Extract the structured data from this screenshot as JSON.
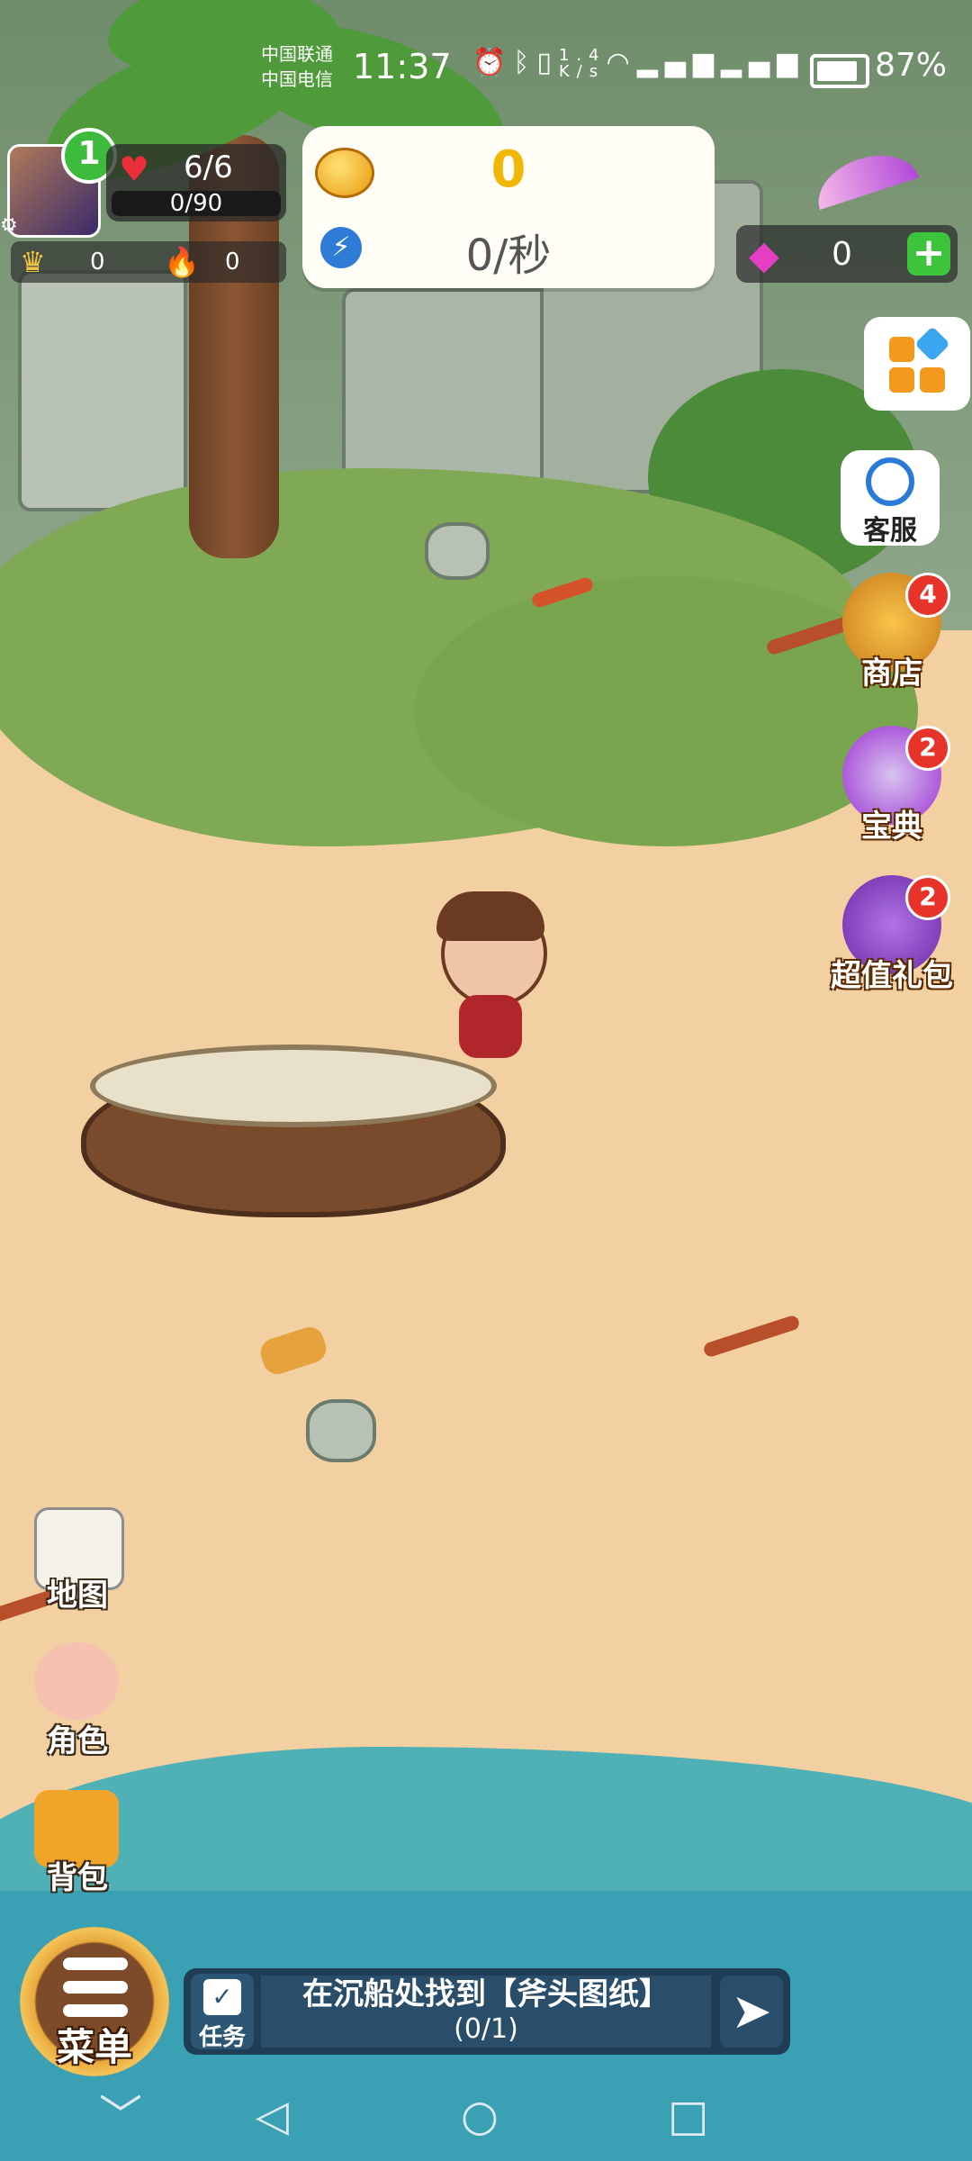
{
  "status_bar": {
    "carrier_1": "中国联通",
    "carrier_2": "中国电信",
    "time": "11:37",
    "net_speed": "1.4\nK/s",
    "battery_percent": "87%",
    "battery_level": 0.87,
    "icons": [
      "alarm-icon",
      "bluetooth-icon",
      "vibrate-icon",
      "wifi-icon",
      "signal-4g-icon",
      "signal-4g-icon"
    ]
  },
  "player": {
    "level": "1",
    "hp": "6/6",
    "xp": "0/90",
    "crowns": "0",
    "fire": "0"
  },
  "resources": {
    "gold": "0",
    "gold_rate": "0/秒"
  },
  "gems": {
    "count": "0",
    "add_label": "+"
  },
  "right_menu": {
    "customer_service": "客服",
    "shop": {
      "label": "商店",
      "badge": "4"
    },
    "codex": {
      "label": "宝典",
      "badge": "2"
    },
    "gift_pack": {
      "label": "超值礼包",
      "badge": "2"
    }
  },
  "left_menu": {
    "map": "地图",
    "character": "角色",
    "backpack": "背包"
  },
  "bottom": {
    "menu": "菜单",
    "task_label": "任务",
    "task_text": "在沉船处找到【斧头图纸】",
    "task_progress": "(0/1)"
  },
  "nav": {
    "back": "◁",
    "home": "○",
    "recents": "□",
    "collapse": "﹀"
  },
  "colors": {
    "gold": "#f2b705",
    "gem": "#e63fc5",
    "badge": "#e8332a",
    "task_bar": "#1f3d55"
  }
}
